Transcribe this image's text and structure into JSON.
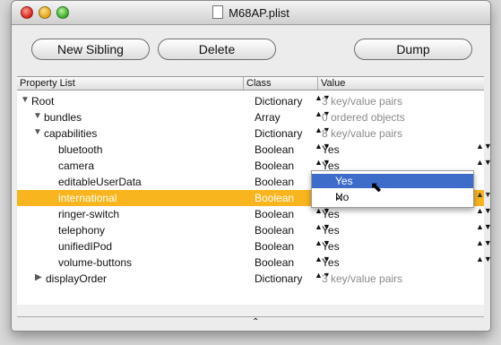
{
  "window": {
    "title": "M68AP.plist"
  },
  "toolbar": {
    "new_sibling": "New Sibling",
    "delete": "Delete",
    "dump": "Dump"
  },
  "columns": {
    "property_list": "Property List",
    "class": "Class",
    "value": "Value"
  },
  "rows": [
    {
      "key": "Root",
      "class": "Dictionary",
      "value": "3 key/value pairs"
    },
    {
      "key": "bundles",
      "class": "Array",
      "value": "0 ordered objects"
    },
    {
      "key": "capabilities",
      "class": "Dictionary",
      "value": "8 key/value pairs"
    },
    {
      "key": "bluetooth",
      "class": "Boolean",
      "value": "Yes"
    },
    {
      "key": "camera",
      "class": "Boolean",
      "value": "Yes"
    },
    {
      "key": "editableUserData",
      "class": "Boolean",
      "value": ""
    },
    {
      "key": "international",
      "class": "Boolean",
      "value": ""
    },
    {
      "key": "ringer-switch",
      "class": "Boolean",
      "value": "Yes"
    },
    {
      "key": "telephony",
      "class": "Boolean",
      "value": "Yes"
    },
    {
      "key": "unifiedIPod",
      "class": "Boolean",
      "value": "Yes"
    },
    {
      "key": "volume-buttons",
      "class": "Boolean",
      "value": "Yes"
    },
    {
      "key": "displayOrder",
      "class": "Dictionary",
      "value": "3 key/value pairs"
    }
  ],
  "popup": {
    "options": [
      "Yes",
      "No"
    ],
    "checkmark": "✓"
  },
  "icons": {
    "expanded": "▼",
    "collapsed": "▶",
    "stepper": "▲▼",
    "grip": "⌃",
    "cursor": "⬉"
  }
}
